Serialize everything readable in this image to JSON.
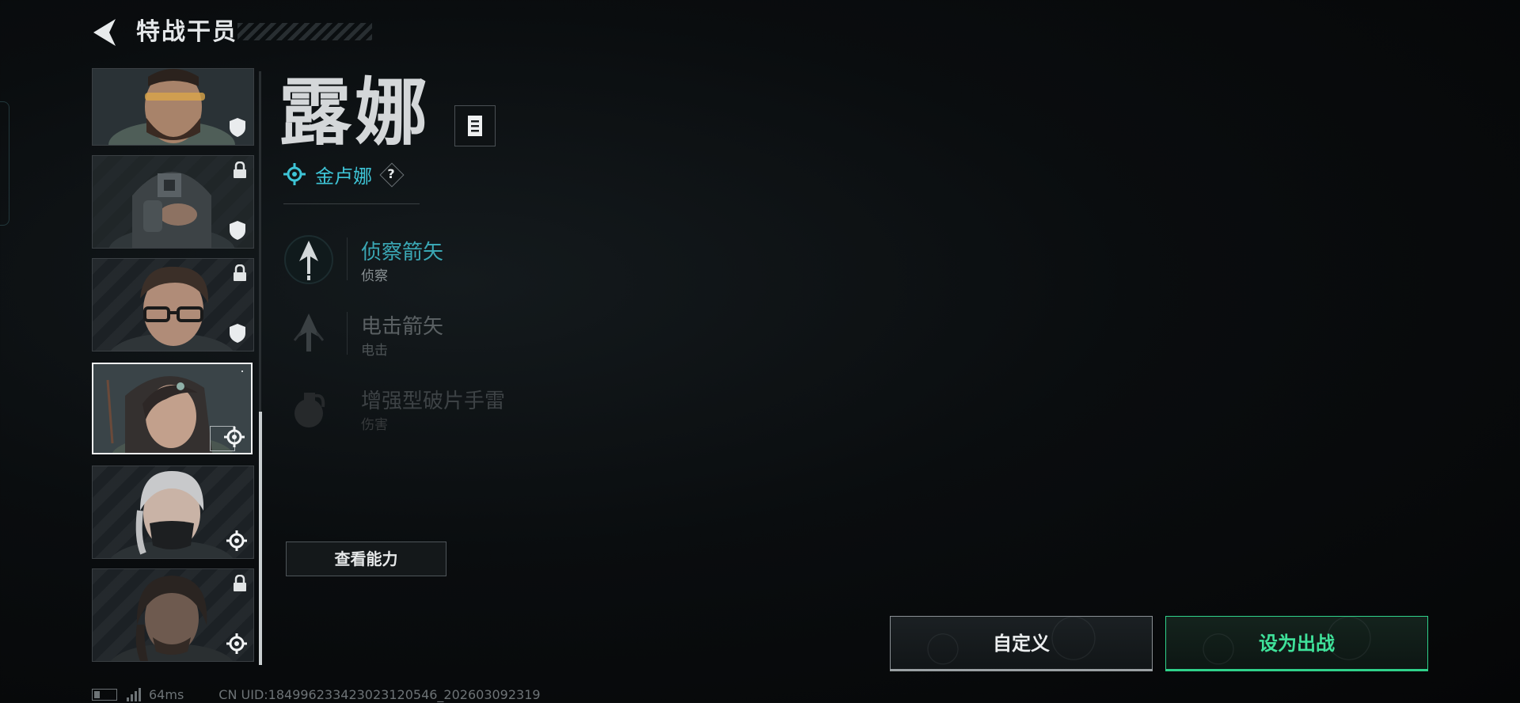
{
  "header": {
    "title": "特战干员"
  },
  "operator": {
    "name": "露娜",
    "faction": "金卢娜",
    "help": "?"
  },
  "abilities": [
    {
      "name": "侦察箭矢",
      "type": "侦察",
      "state": "selected"
    },
    {
      "name": "电击箭矢",
      "type": "电击",
      "state": "dim"
    },
    {
      "name": "增强型破片手雷",
      "type": "伤害",
      "state": "dimmer"
    }
  ],
  "buttons": {
    "view_ability": "查看能力",
    "customize": "自定义",
    "deploy": "设为出战"
  },
  "roster": [
    {
      "id": "bearded-operator",
      "locked": false,
      "badge": "shield-icon"
    },
    {
      "id": "masked-operator",
      "locked": true,
      "badge": "shield-icon"
    },
    {
      "id": "glasses-operator",
      "locked": true,
      "badge": "shield-icon"
    },
    {
      "id": "luna",
      "locked": false,
      "badge": "crosshair-icon",
      "selected": true
    },
    {
      "id": "braided-operator",
      "locked": false,
      "badge": "crosshair-icon"
    },
    {
      "id": "long-hair-operator",
      "locked": true,
      "badge": "crosshair-icon"
    }
  ],
  "status": {
    "ping": "64ms",
    "uid": "CN UID:184996233423023120546_202603092319"
  },
  "colors": {
    "accent_cyan": "#3ec4d6",
    "deploy_green": "#3fe29a",
    "background": "#0a0d0f"
  }
}
